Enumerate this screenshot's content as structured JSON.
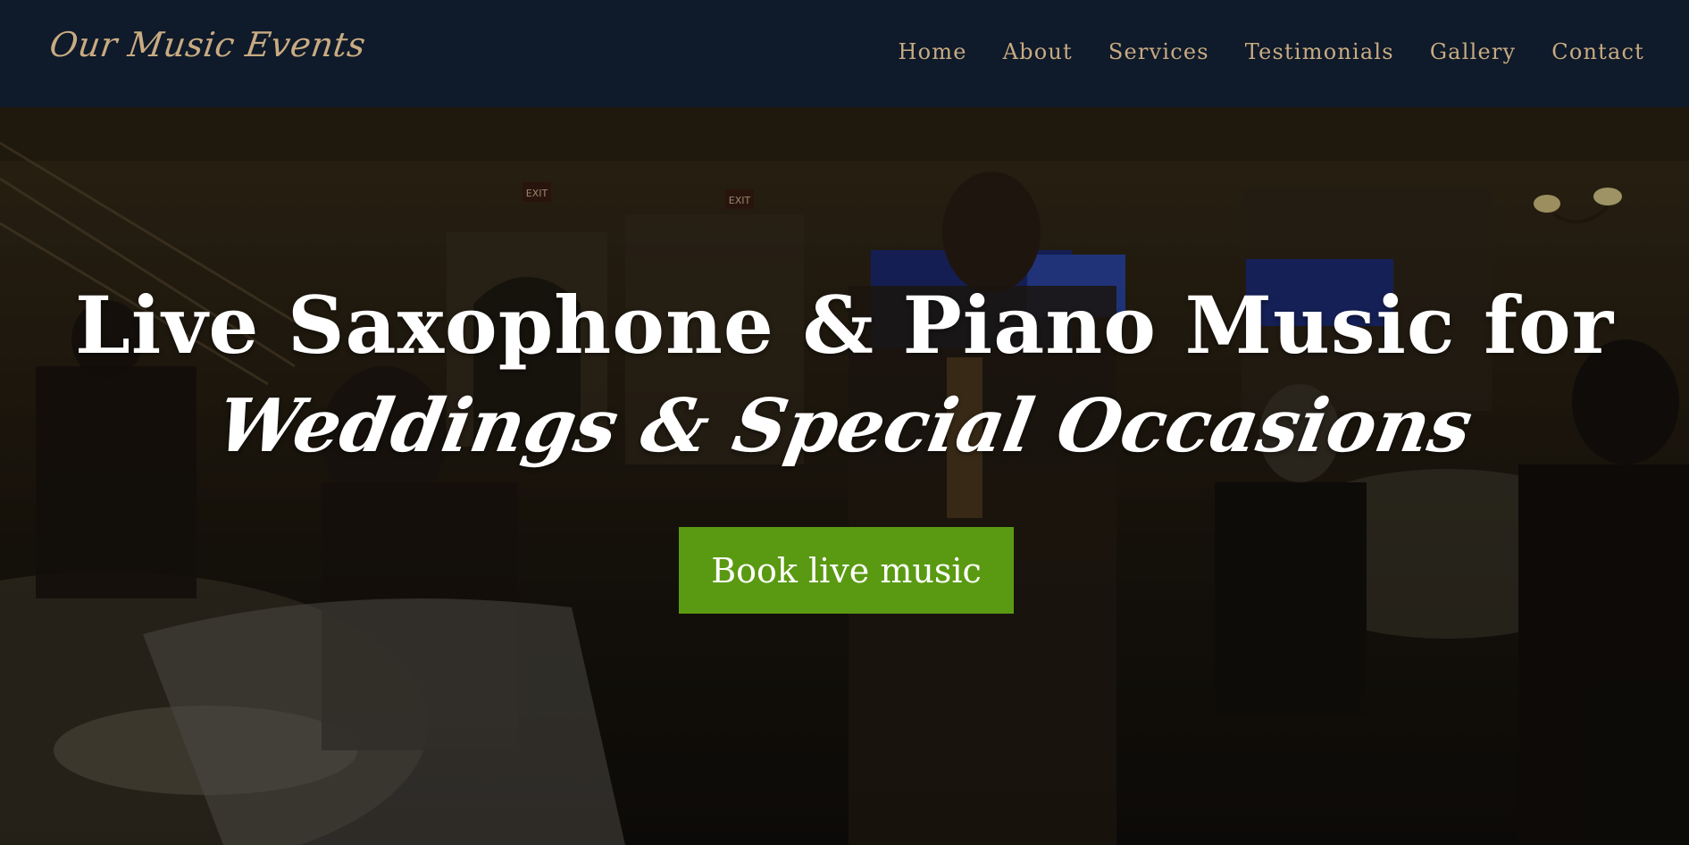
{
  "header": {
    "logo_text": "Our Music Events",
    "nav": [
      {
        "label": "Home"
      },
      {
        "label": "About"
      },
      {
        "label": "Services"
      },
      {
        "label": "Testimonials"
      },
      {
        "label": "Gallery"
      },
      {
        "label": "Contact"
      }
    ]
  },
  "hero": {
    "title": "Live Saxophone & Piano Music for",
    "subtitle": "Weddings & Special Occasions",
    "cta_label": "Book live music",
    "background_scene": {
      "exit_signs": [
        "EXIT",
        "EXIT"
      ]
    }
  },
  "colors": {
    "header_bg": "#0f1a2a",
    "nav_text": "#c8ab82",
    "cta_bg": "#5a9a12",
    "hero_text": "#ffffff"
  }
}
